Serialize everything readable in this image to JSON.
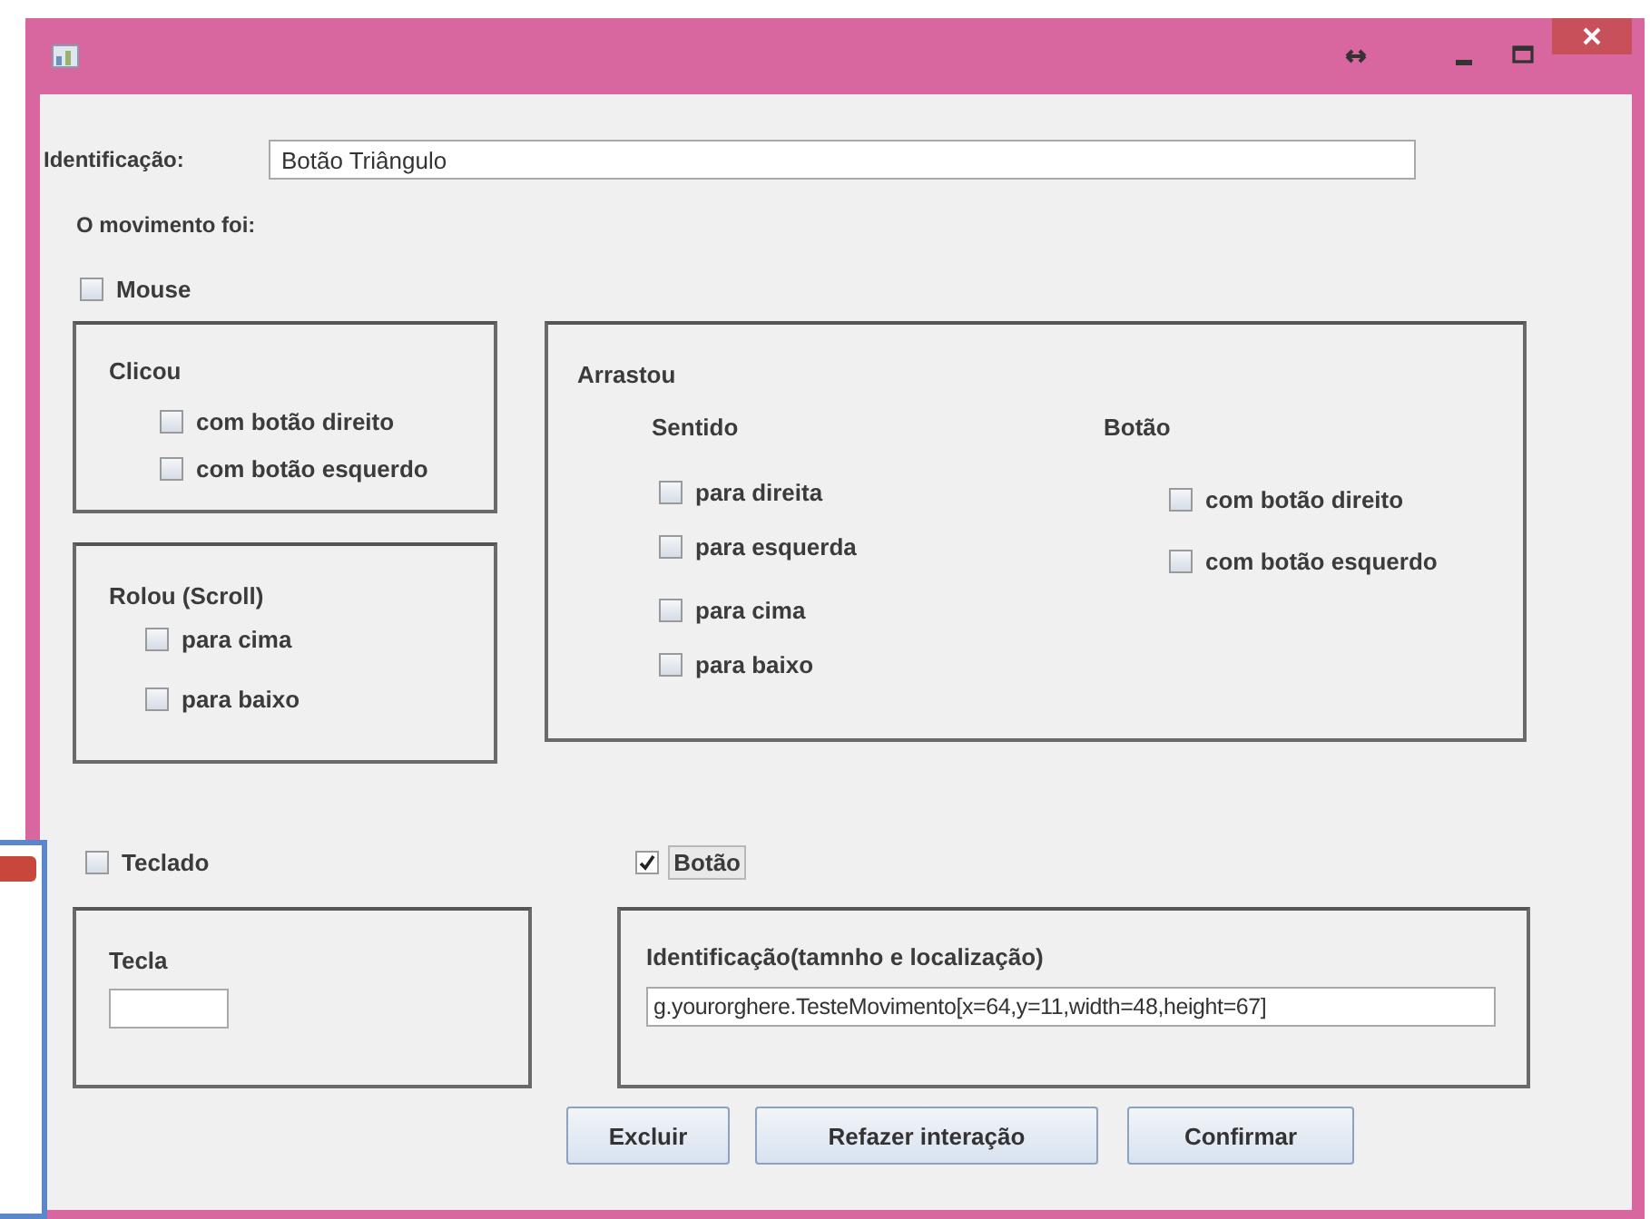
{
  "identification": {
    "label": "Identificação:",
    "value": "Botão Triângulo"
  },
  "movement_label": "O movimento foi:",
  "mouse": {
    "label": "Mouse",
    "checked": false
  },
  "clicked": {
    "title": "Clicou",
    "options": [
      {
        "label": "com botão direito",
        "checked": false
      },
      {
        "label": "com botão esquerdo",
        "checked": false
      }
    ]
  },
  "scrolled": {
    "title": "Rolou (Scroll)",
    "options": [
      {
        "label": "para cima",
        "checked": false
      },
      {
        "label": "para baixo",
        "checked": false
      }
    ]
  },
  "dragged": {
    "title": "Arrastou",
    "direction": {
      "title": "Sentido",
      "options": [
        {
          "label": "para direita",
          "checked": false
        },
        {
          "label": "para esquerda",
          "checked": false
        },
        {
          "label": "para cima",
          "checked": false
        },
        {
          "label": "para baixo",
          "checked": false
        }
      ]
    },
    "button": {
      "title": "Botão",
      "options": [
        {
          "label": "com botão direito",
          "checked": false
        },
        {
          "label": "com botão esquerdo",
          "checked": false
        }
      ]
    }
  },
  "keyboard": {
    "label": "Teclado",
    "checked": false
  },
  "button_check": {
    "label": "Botão",
    "checked": true
  },
  "key_box": {
    "title": "Tecla"
  },
  "button_ident": {
    "title": "Identificação(tamnho e localização)",
    "value": "g.yourorghere.TesteMovimento[x=64,y=11,width=48,height=67]"
  },
  "buttons": [
    "Excluir",
    "Refazer interação",
    "Confirmar"
  ]
}
